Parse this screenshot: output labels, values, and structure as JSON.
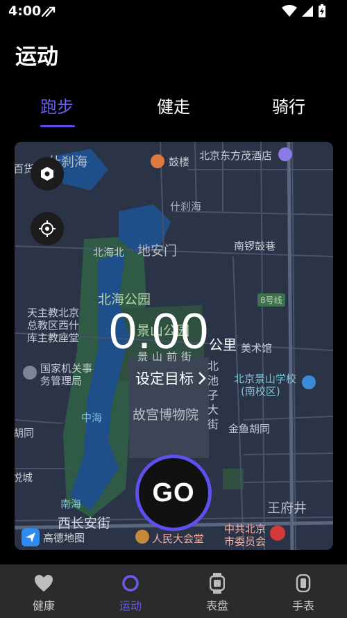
{
  "status_bar": {
    "time": "4:00"
  },
  "page_title": "运动",
  "tabs": [
    {
      "label": "跑步",
      "active": true
    },
    {
      "label": "健走",
      "active": false
    },
    {
      "label": "骑行",
      "active": false
    }
  ],
  "map": {
    "labels": {
      "shichahai_top": "什刹海",
      "bailou": "百货",
      "gulou": "鼓楼",
      "dongfang_hotel": "北京东方茂酒店",
      "shichahai": "什刹海",
      "beihaibei": "北海北",
      "dianmen": "地安门",
      "nanluoguxiang": "南锣鼓巷",
      "line8": "8号线",
      "beihai_park": "北海公园",
      "church_l1": "天主教北京",
      "church_l2": "总教区西什",
      "church_l3": "库主教座堂",
      "jingshan_park": "景山公园",
      "meishuguan": "美术馆",
      "jingshan_front_st": "景山前街",
      "office_l1": "国家机关事",
      "office_l2": "务管理局",
      "beichizi": "北池子大街",
      "school_l1": "北京景山学校",
      "school_l2": "(南校区)",
      "zhonghai": "中海",
      "palace": "故宫博物院",
      "hutong": "胡同",
      "jinyu": "金鱼胡同",
      "yuecheng": "悦城",
      "nanhai": "南海",
      "wangfujing": "王府井",
      "xichang_st": "西长安街",
      "people_hall": "人民大会堂",
      "party_l1": "中共北京",
      "party_l2": "市委员会"
    },
    "distance": "0.00",
    "unit": "公里",
    "set_goal": "设定目标",
    "go": "GO",
    "provider": "高德地图"
  },
  "bottom_nav": [
    {
      "label": "健康",
      "icon": "heart-icon",
      "active": false
    },
    {
      "label": "运动",
      "icon": "ring-icon",
      "active": true
    },
    {
      "label": "表盘",
      "icon": "watch-face-icon",
      "active": false
    },
    {
      "label": "手表",
      "icon": "watch-icon",
      "active": false
    }
  ],
  "colors": {
    "accent": "#5e4ff0",
    "background": "#000000",
    "nav_bg": "#2b2b2d"
  }
}
